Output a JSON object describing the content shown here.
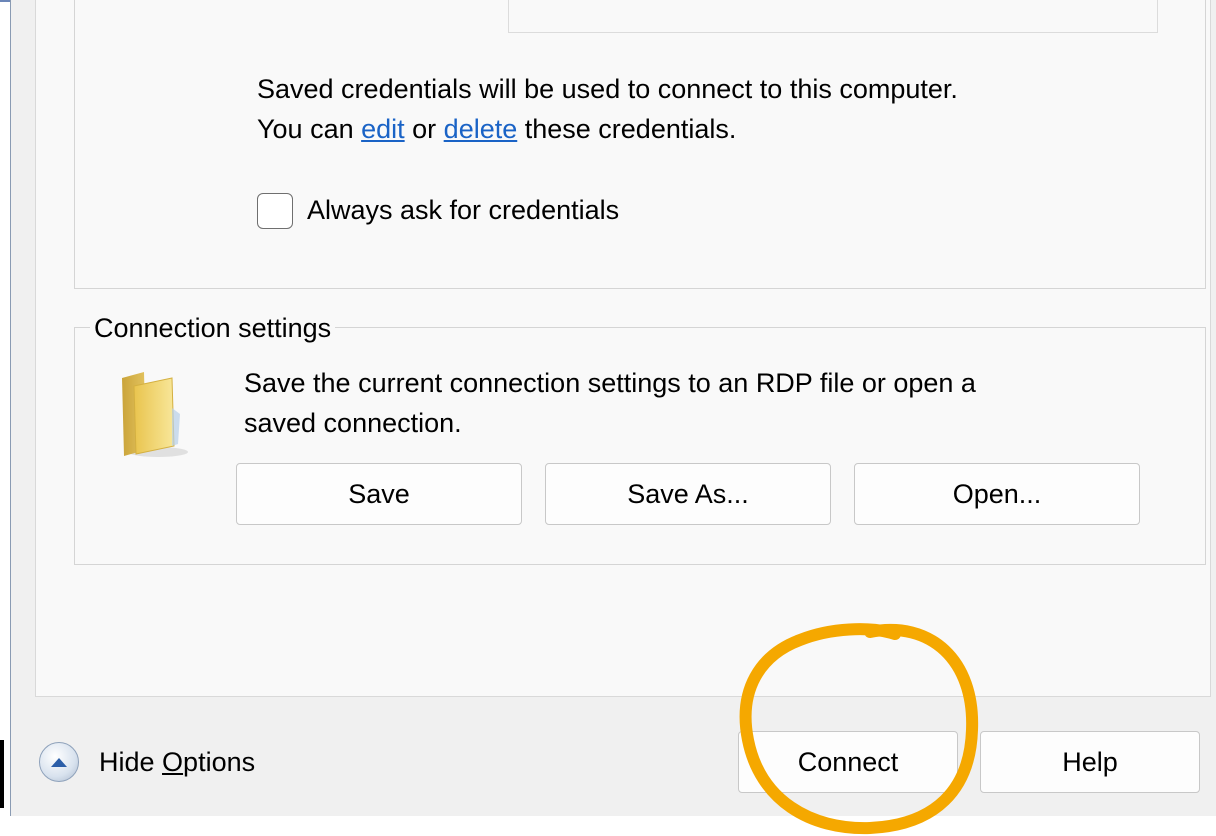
{
  "credentials": {
    "line1": "Saved credentials will be used to connect to this computer.",
    "line2_prefix": "You can ",
    "edit_link": "edit",
    "line2_middle": " or ",
    "delete_link": "delete",
    "line2_suffix": " these credentials.",
    "always_ask_label": "Always ask for credentials",
    "always_ask_checked": false
  },
  "connection_settings": {
    "title": "Connection settings",
    "description_line1": "Save the current connection settings to an RDP file or open a",
    "description_line2": "saved connection.",
    "folder_icon": "folder-icon",
    "buttons": {
      "save": "Save",
      "save_as": "Save As...",
      "open": "Open..."
    }
  },
  "footer": {
    "hide_options_icon": "chevron-up-circle-icon",
    "hide_options_pre": "Hide ",
    "hide_options_accel": "O",
    "hide_options_post": "ptions",
    "connect": "Connect",
    "help": "Help"
  },
  "colors": {
    "link": "#1a63c6",
    "highlight_circle": "#f5a800",
    "folder_yellow": "#f3d76a"
  }
}
